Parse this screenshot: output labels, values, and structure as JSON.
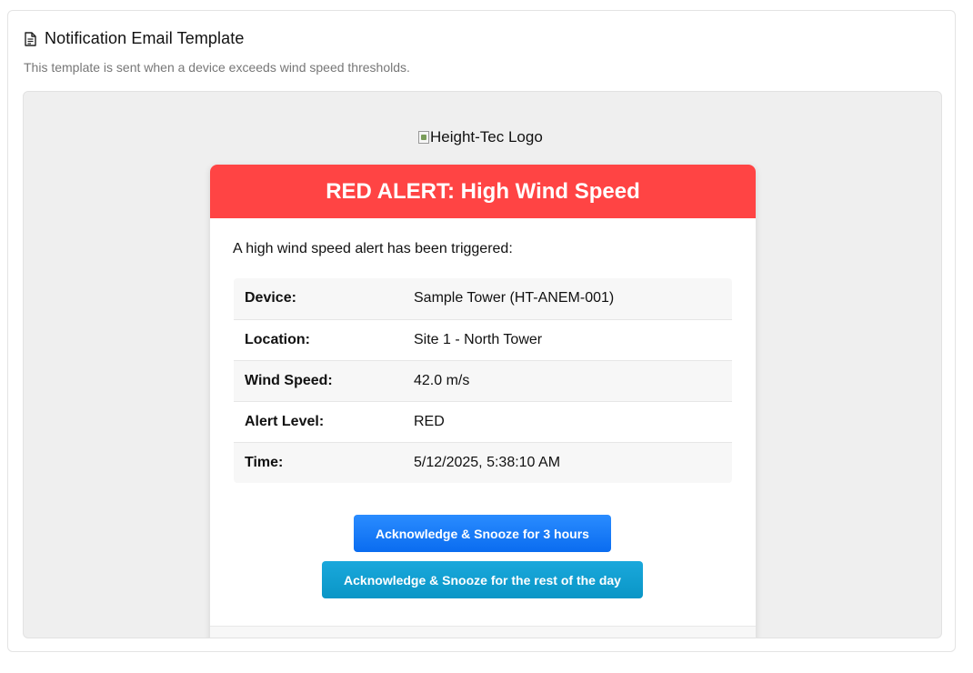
{
  "card": {
    "title": "Notification Email Template",
    "subtitle": "This template is sent when a device exceeds wind speed thresholds.",
    "icon": "document-icon"
  },
  "email": {
    "logo_alt": "Height-Tec Logo",
    "banner_title": "RED ALERT: High Wind Speed",
    "banner_color": "#ff4444",
    "intro": "A high wind speed alert has been triggered:",
    "details": [
      {
        "label": "Device:",
        "value": "Sample Tower (HT-ANEM-001)"
      },
      {
        "label": "Location:",
        "value": "Site 1 - North Tower"
      },
      {
        "label": "Wind Speed:",
        "value": "42.0 m/s"
      },
      {
        "label": "Alert Level:",
        "value": "RED"
      },
      {
        "label": "Time:",
        "value": "5/12/2025, 5:38:10 AM"
      }
    ],
    "buttons": {
      "snooze_3h": "Acknowledge & Snooze for 3 hours",
      "snooze_day": "Acknowledge & Snooze for the rest of the day"
    },
    "button_colors": {
      "primary": "#0a6cf0",
      "secondary": "#0a96c6"
    }
  }
}
